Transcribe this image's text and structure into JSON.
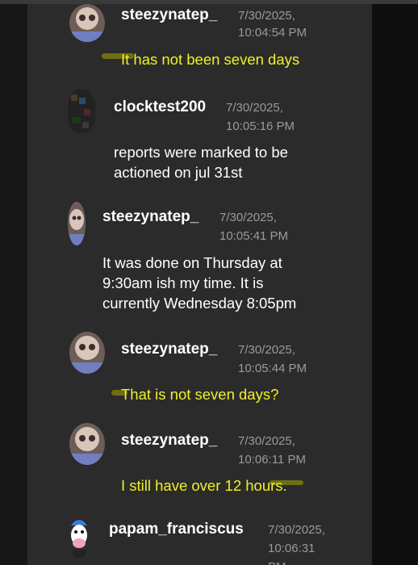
{
  "messages": [
    {
      "username": "steezynatep_",
      "date": "7/30/2025,",
      "time": "10:04:54 PM",
      "lines": [
        "It has not been seven days"
      ],
      "highlighted": true
    },
    {
      "username": "clocktest200",
      "date": "7/30/2025,",
      "time": "10:05:16 PM",
      "lines": [
        "reports were marked to be",
        "actioned on jul 31st"
      ],
      "highlighted": false
    },
    {
      "username": "steezynatep_",
      "date": "7/30/2025,",
      "time": "10:05:41 PM",
      "lines": [
        "It was done on Thursday at",
        "9:30am ish my time. It is",
        "currently Wednesday 8:05pm"
      ],
      "highlighted": false
    },
    {
      "username": "steezynatep_",
      "date": "7/30/2025,",
      "time": "10:05:44 PM",
      "lines": [
        "That is not seven days?"
      ],
      "highlighted": true
    },
    {
      "username": "steezynatep_",
      "date": "7/30/2025,",
      "time": "10:06:11 PM",
      "lines": [
        "I still have over 12 hours."
      ],
      "highlighted": true
    },
    {
      "username": "papam_franciscus",
      "date": "7/30/2025,",
      "time": "10:06:31",
      "time_cut": "PM",
      "lines": [],
      "highlighted": false
    }
  ],
  "colors": {
    "highlight_text": "#f0f02a",
    "panel": "#2b2b2c",
    "timestamp": "#9a9a9a"
  },
  "avatars": [
    "cat-avatar",
    "pixel-avatar",
    "cat-avatar-narrow",
    "cat-avatar",
    "cat-avatar",
    "cartoon-cow-avatar"
  ]
}
